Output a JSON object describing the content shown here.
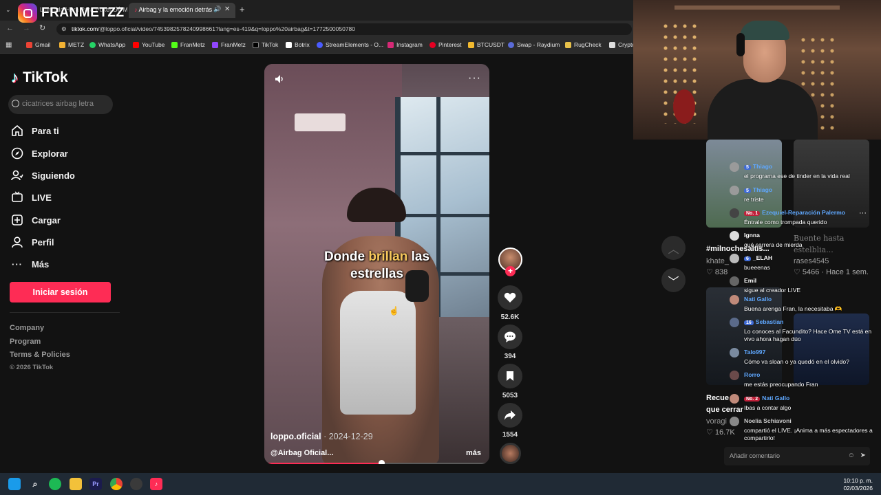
{
  "browser": {
    "tabs": [
      {
        "title": "Llamada Hora Para Poker De M"
      },
      {
        "title": "Airbag y la emoción detrás"
      }
    ],
    "url_host": "tiktok.com",
    "url_path": "/@loppo.oficial/video/7453982578240998661?lang=es-419&q=loppo%20airbag&t=1772500050780",
    "bookmarks": [
      "Gmail",
      "METZ",
      "WhatsApp",
      "YouTube",
      "FranMetz",
      "FranMetz",
      "TikTok",
      "Botrix",
      "StreamElements - O...",
      "Instagram",
      "Pinterest",
      "BTCUSDT",
      "Swap - Raydium",
      "RugCheck",
      "Crypto"
    ]
  },
  "stream": {
    "channel_name": "FRANMETZZ"
  },
  "tiktok": {
    "logo": "TikTok",
    "search_placeholder": "cicatrices airbag letra",
    "nav": [
      "Para ti",
      "Explorar",
      "Siguiendo",
      "LIVE",
      "Cargar",
      "Perfil",
      "Más"
    ],
    "login_button": "Iniciar sesión",
    "footer": [
      "Company",
      "Program",
      "Terms & Policies"
    ],
    "copyright": "© 2026 TikTok"
  },
  "video": {
    "lyric_1": "Donde",
    "lyric_hl": "brillan",
    "lyric_2": "las",
    "lyric_3": "estrellas",
    "author": "loppo.oficial",
    "date": "· 2024-12-29",
    "description": "@Airbag Oficial...",
    "more": "más",
    "progress": 0.52,
    "likes": "52.6K",
    "comments": "394",
    "saves": "5053",
    "shares": "1554"
  },
  "recommendations": {
    "item1_tag": "#milnochesaltis...",
    "item1_user": "khate_",
    "item1_likes": "838",
    "item1_other": "rases4545",
    "item1_views": "5466 · Hace 1 sem.",
    "item2_title": "Recue",
    "item2_sub": "que cerrar",
    "item2_user": "voragi",
    "item2_likes": "16.7K",
    "overlay_1": "Buente hasta",
    "overlay_2": "estelblia..."
  },
  "chat": {
    "messages": [
      {
        "name": "Thiago",
        "badge": "5",
        "text": "el programa ese de tinder en la vida real",
        "color": "#5fa8ff"
      },
      {
        "name": "Thiago",
        "badge": "5",
        "text": "re triste",
        "color": "#5fa8ff"
      },
      {
        "name": "Ezequiel-Reparación Palermo",
        "badge": "No. 1",
        "text": "Éntrale como trompada querido",
        "color": "#5fa8ff"
      },
      {
        "name": "Ignna",
        "badge": "",
        "text": "qué carrera de mierda",
        "color": "#ffffff"
      },
      {
        "name": "_ELAH",
        "badge": "6",
        "text": "bueeenas",
        "color": "#ffffff"
      },
      {
        "name": "Emil",
        "badge": "",
        "text": "sigue al creador LIVE",
        "color": "#ffffff"
      },
      {
        "name": "Nati Gallo",
        "badge": "",
        "text": "Buena arenga Fran, la necesitaba 🫶",
        "color": "#5fa8ff"
      },
      {
        "name": "Sebastian",
        "badge": "16",
        "text": "Lo conoces al Facundito? Hace Ome TV está en vivo ahora hagan dúo",
        "color": "#5fa8ff"
      },
      {
        "name": "Talo997",
        "badge": "",
        "text": "Cómo va sloan o ya quedó en el olvido?",
        "color": "#5fa8ff"
      },
      {
        "name": "Rorro",
        "badge": "",
        "text": "me estás preocupando Fran",
        "color": "#5fa8ff"
      },
      {
        "name": "Nati Gallo",
        "badge": "No. 2",
        "text": "Ibas a contar algo",
        "color": "#5fa8ff"
      },
      {
        "name": "Noelia Schiavoni",
        "badge": "",
        "text": "compartió el LIVE. ¡Anima a más espectadores a compartirlo!",
        "color": "#cccccc"
      }
    ],
    "input_placeholder": "Añadir comentario"
  },
  "taskbar": {
    "time": "10:10 p. m.",
    "date": "02/03/2026"
  },
  "colors": {
    "accent": "#fe2c55",
    "chat_name": "#5fa8ff",
    "highlight": "#f7c85c"
  }
}
